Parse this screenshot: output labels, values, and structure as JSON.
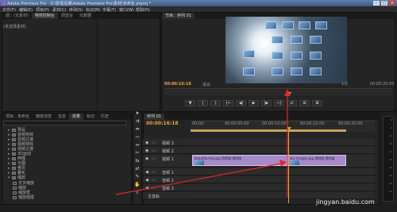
{
  "window": {
    "title": "Adobe Premiere Pro - D:\\影视后期\\Adobe Premiere Pro\\素材\\未命名.prproj *",
    "buttons": [
      "–",
      "□",
      "×"
    ]
  },
  "menubar": [
    "文件(F)",
    "编辑(E)",
    "项目(P)",
    "素材(C)",
    "序列(S)",
    "标记(M)",
    "字幕(T)",
    "窗口(W)",
    "帮助(H)"
  ],
  "source_panel": {
    "tabs": [
      "源：(无素材)",
      "特效控制台",
      "调音台",
      "元数据"
    ],
    "info": "(未选择素材)"
  },
  "program_panel": {
    "tabs": [
      "节目：序列 01"
    ],
    "timecode": "00:00:16:18",
    "fit_label": "适合",
    "duration": "00:00:20:00",
    "ratio": "1/2",
    "transport": [
      "▼",
      "{",
      "}",
      "{←",
      "◀|",
      "▶",
      "|▶",
      "→}",
      "⇄",
      "⊞",
      "⧉"
    ]
  },
  "project_panel": {
    "tabs": [
      "项目：未命名",
      "媒体浏览",
      "信息",
      "效果",
      "标记",
      "历史"
    ],
    "search_placeholder": "",
    "tree": [
      {
        "label": "预设",
        "type": "folder"
      },
      {
        "label": "音频特效",
        "type": "folder"
      },
      {
        "label": "音频过渡",
        "type": "folder"
      },
      {
        "label": "视频特效",
        "type": "folder"
      },
      {
        "label": "视频过渡",
        "type": "folder"
      },
      {
        "label": "3D运动",
        "type": "folder"
      },
      {
        "label": "伸展",
        "type": "folder"
      },
      {
        "label": "光圈",
        "type": "folder"
      },
      {
        "label": "卷页",
        "type": "folder"
      },
      {
        "label": "叠化",
        "type": "folder"
      },
      {
        "label": "擦除",
        "type": "folder"
      },
      {
        "label": "映射",
        "type": "folder"
      },
      {
        "label": "滑动",
        "type": "folder"
      },
      {
        "label": "特殊效果",
        "type": "folder"
      },
      {
        "label": "缩放",
        "type": "folder"
      }
    ],
    "subtree": [
      {
        "label": "交叉缩放"
      },
      {
        "label": "缩放"
      },
      {
        "label": "缩放框"
      },
      {
        "label": "缩放拖尾"
      }
    ]
  },
  "timeline": {
    "tabs": [
      "序列 01"
    ],
    "timecode": "00:00:16:18",
    "ruler_labels": [
      "00:00",
      "00:00:05:00",
      "00:00:10:00",
      "00:00:15:00",
      "00:00:20:00"
    ],
    "tracks": [
      {
        "label": "视频 3"
      },
      {
        "label": "视频 2"
      },
      {
        "label": "视频 1"
      },
      {
        "label": "音频 1"
      },
      {
        "label": "音频 2"
      },
      {
        "label": "音频 3"
      },
      {
        "label": "主音轨"
      }
    ],
    "clips": [
      {
        "label": "beautiful-sky.jpg 透明度:透明度"
      },
      {
        "label": "sky-images.jpg  透明度:透明度"
      }
    ]
  },
  "meter": {
    "labels": [
      "0",
      "-6",
      "-12",
      "-18",
      "-24",
      "-30",
      "-36",
      "-42",
      "-48",
      "-54"
    ]
  },
  "watermark": "jingyan.baidu.com",
  "colors": {
    "timecode": "#e8a23a",
    "clip": "#a58bc9",
    "annotation": "#e0282a"
  }
}
